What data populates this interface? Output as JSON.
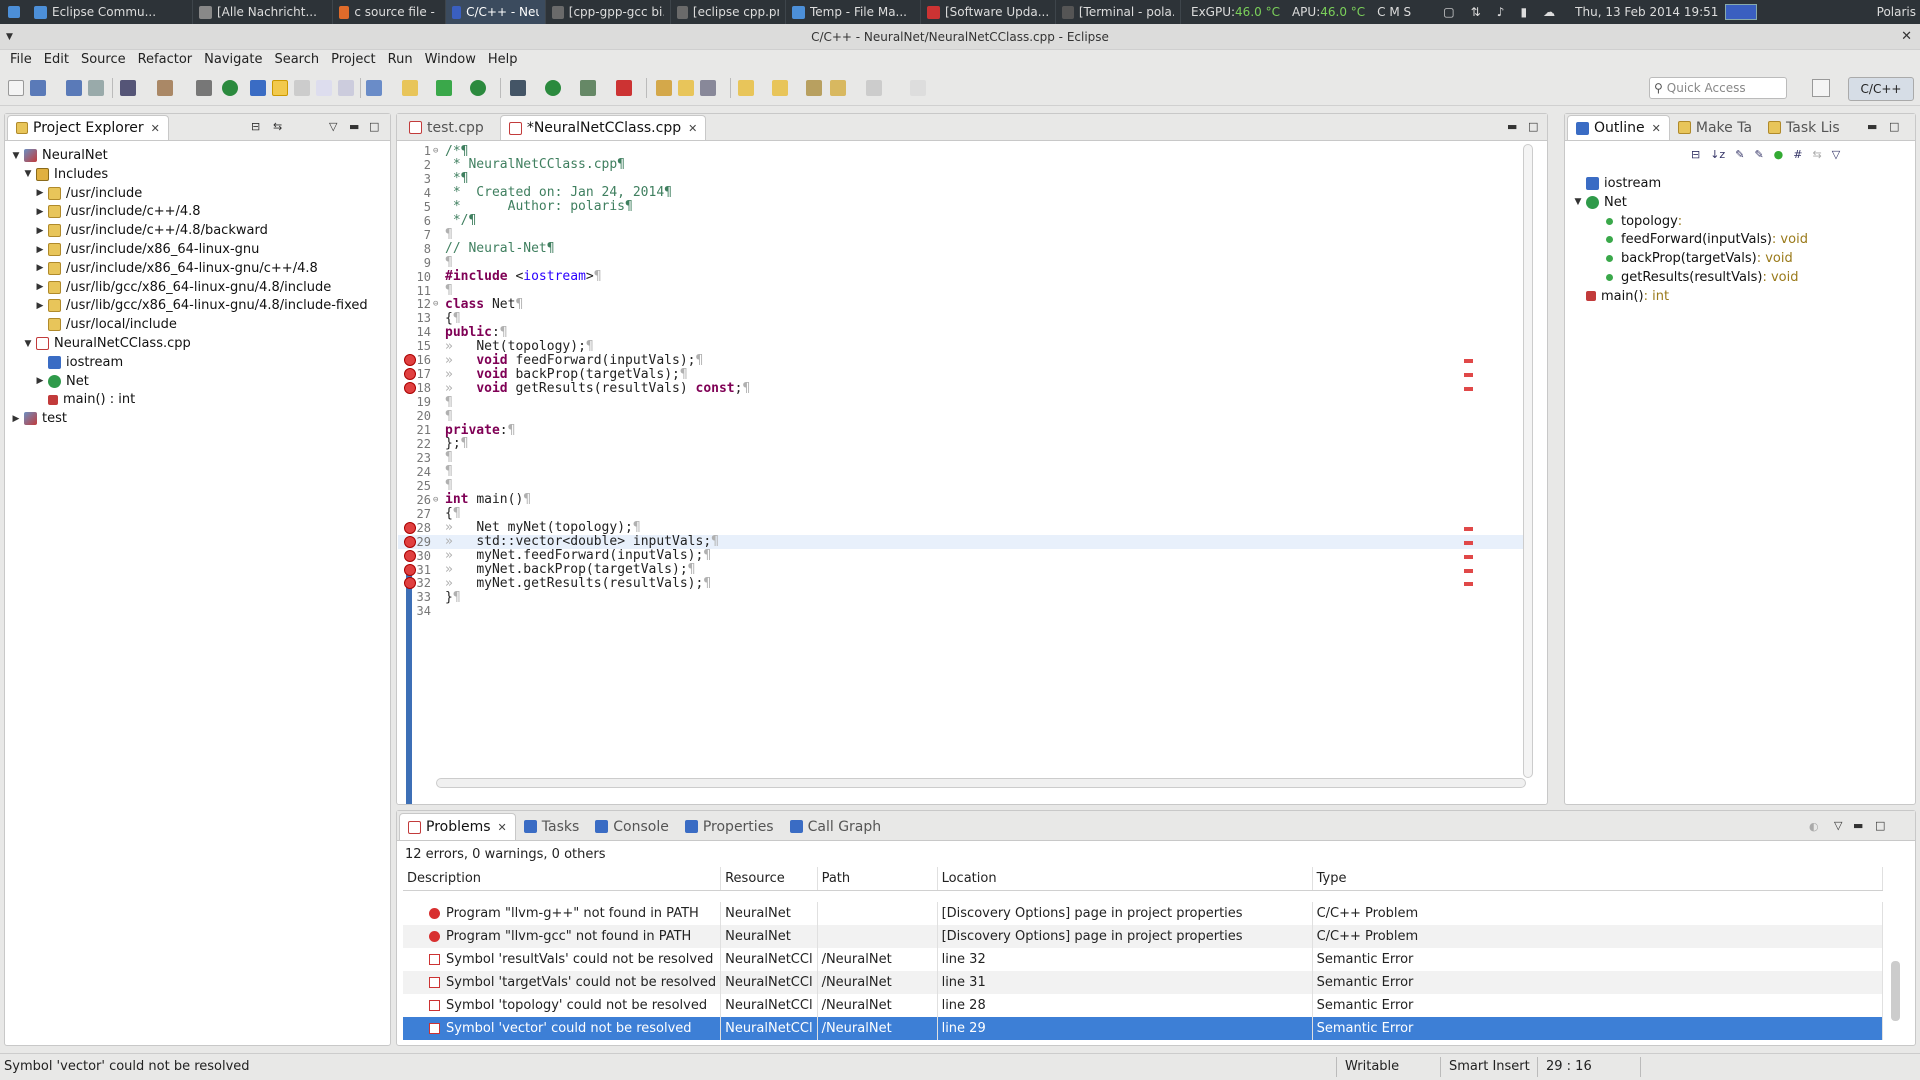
{
  "taskbar": {
    "tasks": [
      "Eclipse Commu...",
      "[Alle Nachricht...",
      "c source file - Ix...",
      "C/C++ - Neural...",
      "[cpp-gpp-gcc bi...",
      "[eclipse cpp.pn...",
      "Temp - File Ma...",
      "[Software Upda...",
      "[Terminal - pola..."
    ],
    "exgpu_label": "ExGPU:",
    "exgpu_temp": "46.0 °C",
    "apu_label": "APU:",
    "apu_temp": "46.0 °C",
    "keys": "C  M  S",
    "datetime": "Thu, 13 Feb 2014 19:51",
    "user": "Polaris"
  },
  "window": {
    "title": "C/C++ - NeuralNet/NeuralNetCClass.cpp - Eclipse"
  },
  "menu": [
    "File",
    "Edit",
    "Source",
    "Refactor",
    "Navigate",
    "Search",
    "Project",
    "Run",
    "Window",
    "Help"
  ],
  "toolbar": {
    "quick_access_placeholder": "Quick Access",
    "perspective": "C/C++"
  },
  "project_explorer": {
    "title": "Project Explorer",
    "rows": [
      {
        "label": "NeuralNet",
        "level": 0,
        "twisty": "▼",
        "icon": "project-icon"
      },
      {
        "label": "Includes",
        "level": 1,
        "twisty": "▼",
        "icon": "includes-folder-icon"
      },
      {
        "label": "/usr/include",
        "level": 2,
        "twisty": "▶",
        "icon": "include-folder-icon"
      },
      {
        "label": "/usr/include/c++/4.8",
        "level": 2,
        "twisty": "▶",
        "icon": "include-folder-icon"
      },
      {
        "label": "/usr/include/c++/4.8/backward",
        "level": 2,
        "twisty": "▶",
        "icon": "include-folder-icon"
      },
      {
        "label": "/usr/include/x86_64-linux-gnu",
        "level": 2,
        "twisty": "▶",
        "icon": "include-folder-icon"
      },
      {
        "label": "/usr/include/x86_64-linux-gnu/c++/4.8",
        "level": 2,
        "twisty": "▶",
        "icon": "include-folder-icon"
      },
      {
        "label": "/usr/lib/gcc/x86_64-linux-gnu/4.8/include",
        "level": 2,
        "twisty": "▶",
        "icon": "include-folder-icon"
      },
      {
        "label": "/usr/lib/gcc/x86_64-linux-gnu/4.8/include-fixed",
        "level": 2,
        "twisty": "▶",
        "icon": "include-folder-icon"
      },
      {
        "label": "/usr/local/include",
        "level": 2,
        "twisty": "",
        "icon": "include-folder-icon"
      },
      {
        "label": "NeuralNetCClass.cpp",
        "level": 1,
        "twisty": "▼",
        "icon": "cpp-file-icon"
      },
      {
        "label": "iostream",
        "level": 2,
        "twisty": "",
        "icon": "include-icon"
      },
      {
        "label": "Net",
        "level": 2,
        "twisty": "▶",
        "icon": "class-icon"
      },
      {
        "label": "main() : int",
        "level": 2,
        "twisty": "",
        "icon": "function-icon"
      },
      {
        "label": "test",
        "level": 0,
        "twisty": "▶",
        "icon": "project-icon"
      }
    ]
  },
  "editor": {
    "tabs": [
      {
        "label": "test.cpp",
        "active": false
      },
      {
        "label": "*NeuralNetCClass.cpp",
        "active": true
      }
    ],
    "lines": [
      {
        "n": "1",
        "text": "/*¶",
        "error": false,
        "fold": "⊖"
      },
      {
        "n": "2",
        "text": " * NeuralNetCClass.cpp¶",
        "error": false
      },
      {
        "n": "3",
        "text": " *¶",
        "error": false
      },
      {
        "n": "4",
        "text": " *  Created on: Jan 24, 2014¶",
        "error": false
      },
      {
        "n": "5",
        "text": " *      Author: polaris¶",
        "error": false
      },
      {
        "n": "6",
        "text": " */¶",
        "error": false
      },
      {
        "n": "7",
        "text": "¶",
        "error": false
      },
      {
        "n": "8",
        "text": "// Neural-Net¶",
        "error": false
      },
      {
        "n": "9",
        "text": "¶",
        "error": false
      },
      {
        "n": "10",
        "text": "#include <iostream>¶",
        "error": false
      },
      {
        "n": "11",
        "text": "¶",
        "error": false
      },
      {
        "n": "12",
        "text": "class Net¶",
        "error": false,
        "fold": "⊖"
      },
      {
        "n": "13",
        "text": "{¶",
        "error": false
      },
      {
        "n": "14",
        "text": "public:¶",
        "error": false
      },
      {
        "n": "15",
        "text": "»   Net(topology);¶",
        "error": false
      },
      {
        "n": "16",
        "text": "»   void feedForward(inputVals);¶",
        "error": true
      },
      {
        "n": "17",
        "text": "»   void backProp(targetVals);¶",
        "error": true
      },
      {
        "n": "18",
        "text": "»   void getResults(resultVals) const;¶",
        "error": true
      },
      {
        "n": "19",
        "text": "¶",
        "error": false
      },
      {
        "n": "20",
        "text": "¶",
        "error": false
      },
      {
        "n": "21",
        "text": "private:¶",
        "error": false
      },
      {
        "n": "22",
        "text": "};¶",
        "error": false
      },
      {
        "n": "23",
        "text": "¶",
        "error": false
      },
      {
        "n": "24",
        "text": "¶",
        "error": false
      },
      {
        "n": "25",
        "text": "¶",
        "error": false
      },
      {
        "n": "26",
        "text": "int main()¶",
        "error": false,
        "fold": "⊖"
      },
      {
        "n": "27",
        "text": "{¶",
        "error": false
      },
      {
        "n": "28",
        "text": "»   Net myNet(topology);¶",
        "error": true
      },
      {
        "n": "29",
        "text": "»   std::vector<double> inputVals;¶",
        "error": true
      },
      {
        "n": "30",
        "text": "»   myNet.feedForward(inputVals);¶",
        "error": true
      },
      {
        "n": "31",
        "text": "»   myNet.backProp(targetVals);¶",
        "error": true
      },
      {
        "n": "32",
        "text": "»   myNet.getResults(resultVals);¶",
        "error": true
      },
      {
        "n": "33",
        "text": "}¶",
        "error": false
      },
      {
        "n": "34",
        "text": "",
        "error": false
      }
    ]
  },
  "outline": {
    "tabs": [
      "Outline",
      "Make Ta",
      "Task Lis"
    ],
    "items": [
      {
        "label": "iostream",
        "type": "",
        "level": 0,
        "twisty": "",
        "icon": "include-icon"
      },
      {
        "label": "Net",
        "type": "",
        "level": 0,
        "twisty": "▼",
        "icon": "class-icon"
      },
      {
        "label": "topology",
        "type": " :",
        "level": 1,
        "twisty": "",
        "icon": "public-field-icon"
      },
      {
        "label": "feedForward(inputVals)",
        "type": " : void",
        "level": 1,
        "twisty": "",
        "icon": "public-method-icon"
      },
      {
        "label": "backProp(targetVals)",
        "type": " : void",
        "level": 1,
        "twisty": "",
        "icon": "public-method-icon"
      },
      {
        "label": "getResults(resultVals)",
        "type": " : void",
        "level": 1,
        "twisty": "",
        "icon": "const-method-icon"
      },
      {
        "label": "main()",
        "type": " : int",
        "level": 0,
        "twisty": "",
        "icon": "function-icon"
      }
    ]
  },
  "problems": {
    "tabs": [
      "Problems",
      "Tasks",
      "Console",
      "Properties",
      "Call Graph"
    ],
    "summary": "12 errors, 0 warnings, 0 others",
    "columns": [
      "Description",
      "Resource",
      "Path",
      "Location",
      "Type"
    ],
    "rows": [
      {
        "desc": "Program \"llvm-g++\" not found in PATH",
        "resource": "NeuralNet",
        "path": "",
        "location": "[Discovery Options] page in project properties",
        "type": "C/C++ Problem",
        "kind": "error",
        "selected": false
      },
      {
        "desc": "Program \"llvm-gcc\" not found in PATH",
        "resource": "NeuralNet",
        "path": "",
        "location": "[Discovery Options] page in project properties",
        "type": "C/C++ Problem",
        "kind": "error",
        "selected": false
      },
      {
        "desc": "Symbol 'resultVals' could not be resolved",
        "resource": "NeuralNetCCl",
        "path": "/NeuralNet",
        "location": "line 32",
        "type": "Semantic Error",
        "kind": "semantic",
        "selected": false
      },
      {
        "desc": "Symbol 'targetVals' could not be resolved",
        "resource": "NeuralNetCCl",
        "path": "/NeuralNet",
        "location": "line 31",
        "type": "Semantic Error",
        "kind": "semantic",
        "selected": false
      },
      {
        "desc": "Symbol 'topology' could not be resolved",
        "resource": "NeuralNetCCl",
        "path": "/NeuralNet",
        "location": "line 28",
        "type": "Semantic Error",
        "kind": "semantic",
        "selected": false
      },
      {
        "desc": "Symbol 'vector' could not be resolved",
        "resource": "NeuralNetCCl",
        "path": "/NeuralNet",
        "location": "line 29",
        "type": "Semantic Error",
        "kind": "semantic",
        "selected": true
      }
    ]
  },
  "status": {
    "message": "Symbol 'vector' could not be resolved",
    "writable": "Writable",
    "insert_mode": "Smart Insert",
    "position": "29 : 16"
  },
  "colors": {
    "keyword": "#7f0055",
    "comment": "#3f7f5f",
    "string": "#2a00ff",
    "selection": "#3d7fd6",
    "error": "#e04040"
  }
}
